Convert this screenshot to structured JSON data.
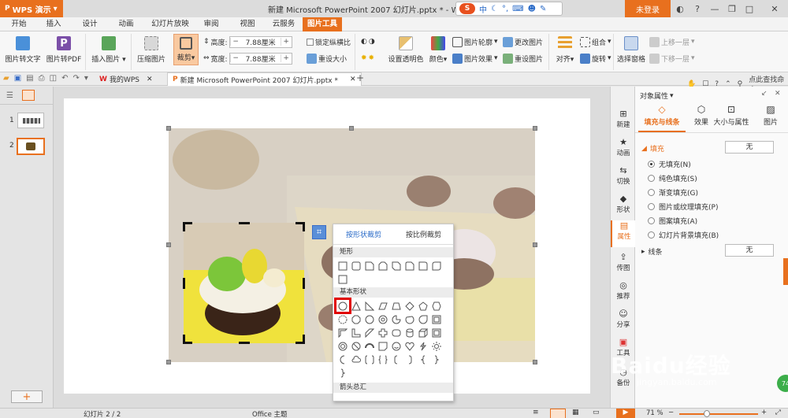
{
  "app": {
    "name": "WPS 演示",
    "doc_title": "新建 Microsoft PowerPoint 2007 幻灯片.pptx * - WPS 演示",
    "login": "未登录"
  },
  "ime": {
    "cn": "中",
    "punct": "°,"
  },
  "menu": {
    "tabs": [
      "开始",
      "插入",
      "设计",
      "动画",
      "幻灯片放映",
      "审阅",
      "视图",
      "云服务",
      "图片工具"
    ],
    "active_index": 8
  },
  "ribbon": {
    "pic_to_text": "图片转文字",
    "pic_to_pdf": "图片转PDF",
    "insert_pic": "插入图片",
    "compress": "压缩图片",
    "crop": "裁剪",
    "height_label": "高度:",
    "height_value": "7.88厘米",
    "width_label": "宽度:",
    "width_value": "7.88厘米",
    "lock_ratio": "锁定纵横比",
    "reset_size": "重设大小",
    "transparent": "设置透明色",
    "color": "颜色",
    "outline": "图片轮廓",
    "effect": "图片效果",
    "change_pic": "更改图片",
    "reset_pic": "重设图片",
    "align": "对齐",
    "group": "组合",
    "rotate": "旋转",
    "selection_pane": "选择窗格",
    "bring_forward": "上移一层",
    "send_backward": "下移一层"
  },
  "doc_tabs": [
    {
      "label": "我的WPS"
    },
    {
      "label": "新建 Microsoft PowerPoint 2007 幻灯片.pptx *"
    }
  ],
  "search_cmd": "点此查找命令",
  "slides": {
    "items": [
      "1",
      "2"
    ],
    "current": 2
  },
  "crop_popup": {
    "tab_shape": "按形状裁剪",
    "tab_ratio": "按比例裁剪",
    "sections": [
      "矩形",
      "基本形状",
      "箭头总汇"
    ]
  },
  "right_strip": [
    "新建",
    "动画",
    "切换",
    "形状",
    "属性",
    "传图",
    "推荐",
    "分享",
    "工具",
    "备份"
  ],
  "props": {
    "header": "对象属性",
    "tabs": [
      "填充与线条",
      "效果",
      "大小与属性",
      "图片"
    ],
    "fill_title": "填充",
    "fill_value": "无",
    "options": [
      "无填充(N)",
      "纯色填充(S)",
      "渐变填充(G)",
      "图片或纹理填充(P)",
      "图案填充(A)",
      "幻灯片背景填充(B)"
    ],
    "selected_option": 0,
    "line_title": "线条",
    "line_value": "无"
  },
  "status": {
    "slide_info": "幻灯片 2 / 2",
    "theme": "Office 主题",
    "zoom": "71 %"
  },
  "watermark": {
    "brand": "Baidu经验",
    "url": "jingyan.baidu.com"
  },
  "colors": {
    "accent": "#e8701e",
    "highlight": "#e00000",
    "link": "#2a6bc8"
  }
}
